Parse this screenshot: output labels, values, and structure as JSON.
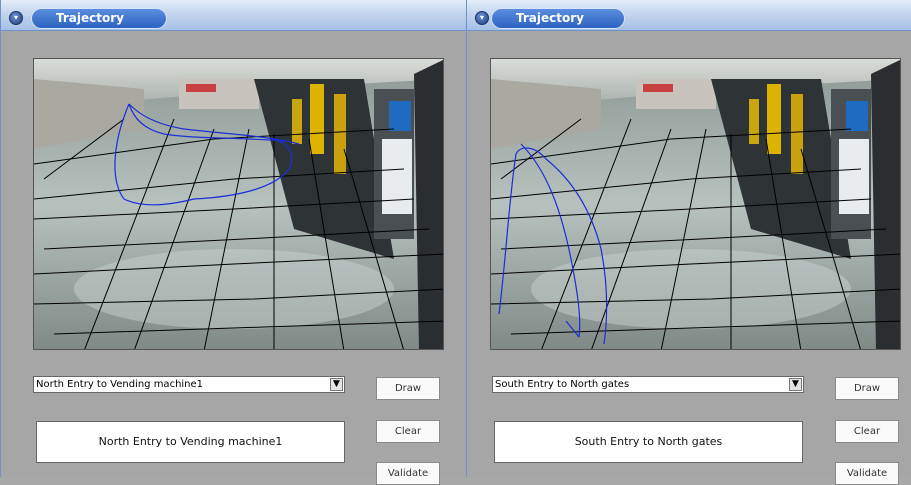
{
  "left": {
    "title": "Trajectory",
    "route_select": "North Entry to Vending machine1",
    "route_display": "North Entry to Vending machine1",
    "buttons": {
      "draw": "Draw",
      "clear": "Clear",
      "validate": "Validate"
    }
  },
  "right": {
    "title": "Trajectory",
    "route_select": "South Entry to North gates",
    "route_display": "South Entry to North gates",
    "buttons": {
      "draw": "Draw",
      "clear": "Clear",
      "validate": "Validate"
    }
  },
  "colors": {
    "trajectory": "#1a2fd6",
    "grid": "#000000",
    "title_tab": "#3a6fcc"
  },
  "icons": {
    "collapse": "chevron-down-icon",
    "dropdown": "dropdown-arrow-icon"
  }
}
